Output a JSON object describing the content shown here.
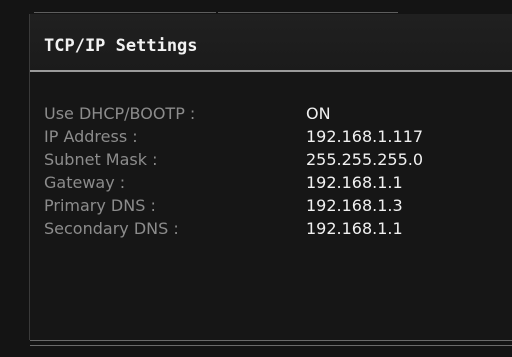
{
  "panel": {
    "title": "TCP/IP Settings"
  },
  "settings": [
    {
      "label": "Use DHCP/BOOTP :",
      "value": "ON"
    },
    {
      "label": "IP Address :",
      "value": "192.168.1.117"
    },
    {
      "label": "Subnet Mask :",
      "value": "255.255.255.0"
    },
    {
      "label": "Gateway :",
      "value": "192.168.1.1"
    },
    {
      "label": "Primary DNS :",
      "value": "192.168.1.3"
    },
    {
      "label": "Secondary DNS :",
      "value": "192.168.1.1"
    }
  ],
  "colors": {
    "background": "#141414",
    "label": "#8c8c8c",
    "value": "#f0f0f0",
    "title": "#f2f2f2",
    "rule": "#9a9a9a"
  }
}
